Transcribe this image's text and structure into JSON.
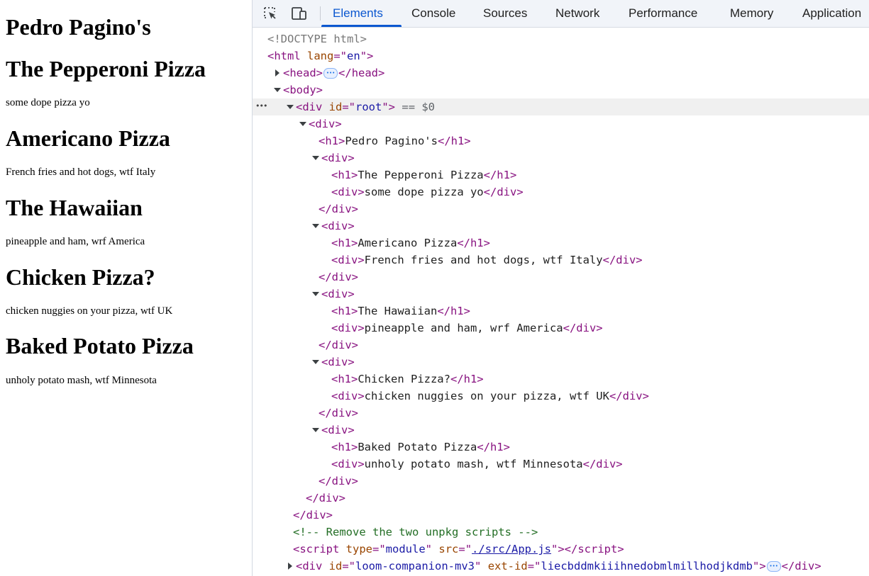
{
  "page": {
    "title": "Pedro Pagino's",
    "pizzas": [
      {
        "name": "The Pepperoni Pizza",
        "desc": "some dope pizza yo"
      },
      {
        "name": "Americano Pizza",
        "desc": "French fries and hot dogs, wtf Italy"
      },
      {
        "name": "The Hawaiian",
        "desc": "pineapple and ham, wrf America"
      },
      {
        "name": "Chicken Pizza?",
        "desc": "chicken nuggies on your pizza, wtf UK"
      },
      {
        "name": "Baked Potato Pizza",
        "desc": "unholy potato mash, wtf Minnesota"
      }
    ]
  },
  "devtools": {
    "toolbar": {
      "inspect_icon": "inspect-element-icon",
      "device_icon": "device-toolbar-icon"
    },
    "tabs": [
      "Elements",
      "Console",
      "Sources",
      "Network",
      "Performance",
      "Memory",
      "Application"
    ],
    "active_tab": "Elements",
    "accent_color": "#0b57d0",
    "dom": {
      "doctype": "<!DOCTYPE html>",
      "html_tag": "html",
      "html_attr_name": "lang",
      "html_attr_value": "en",
      "head_tag": "head",
      "body_tag": "body",
      "root_div_id": "root",
      "selected_marker": "== $0",
      "comment": "<!-- Remove the two unpkg scripts -->",
      "script_type": "module",
      "script_src": "./src/App.js",
      "ext_div_id": "loom-companion-mv3",
      "ext_id": "liecbddmkiiihnedobmlmillhodjkdmb"
    }
  }
}
